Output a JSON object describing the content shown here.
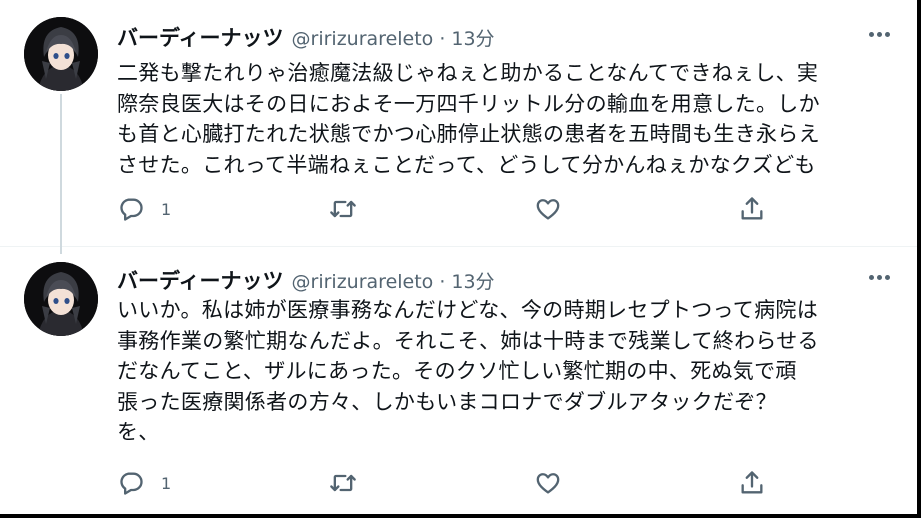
{
  "tweets": [
    {
      "author_name": "バーディーナッツ",
      "author_handle": "@ririzurareleto",
      "separator": "·",
      "time": "13分",
      "text": "二発も撃たれりゃ治癒魔法級じゃねぇと助かることなんてできねぇし、実\n際奈良医大はその日におよそ一万四千リットル分の輸血を用意した。しか\nも首と心臓打たれた状態でかつ心肺停止状態の患者を五時間も生き永らえ\nさせた。これって半端ねぇことだって、どうして分かんねぇかなクズども",
      "reply_count": "1",
      "icons": {
        "more": "more-icon",
        "reply": "reply-icon",
        "retweet": "retweet-icon",
        "like": "like-icon",
        "share": "share-icon"
      }
    },
    {
      "author_name": "バーディーナッツ",
      "author_handle": "@ririzurareleto",
      "separator": "·",
      "time": "13分",
      "text": "いいか。私は姉が医療事務なんだけどな、今の時期レセプトつって病院は\n事務作業の繁忙期なんだよ。それこそ、姉は十時まで残業して終わらせる\nだなんてこと、ザルにあった。そのクソ忙しい繁忙期の中、死ぬ気で頑\n張った医療関係者の方々、しかもいまコロナでダブルアタックだぞ？\nを、",
      "reply_count": "1",
      "icons": {
        "more": "more-icon",
        "reply": "reply-icon",
        "retweet": "retweet-icon",
        "like": "like-icon",
        "share": "share-icon"
      }
    }
  ],
  "colors": {
    "text": "#0f1419",
    "secondary": "#536471",
    "thread_line": "#cfd9de",
    "frame": "#000000",
    "background": "#ffffff"
  }
}
